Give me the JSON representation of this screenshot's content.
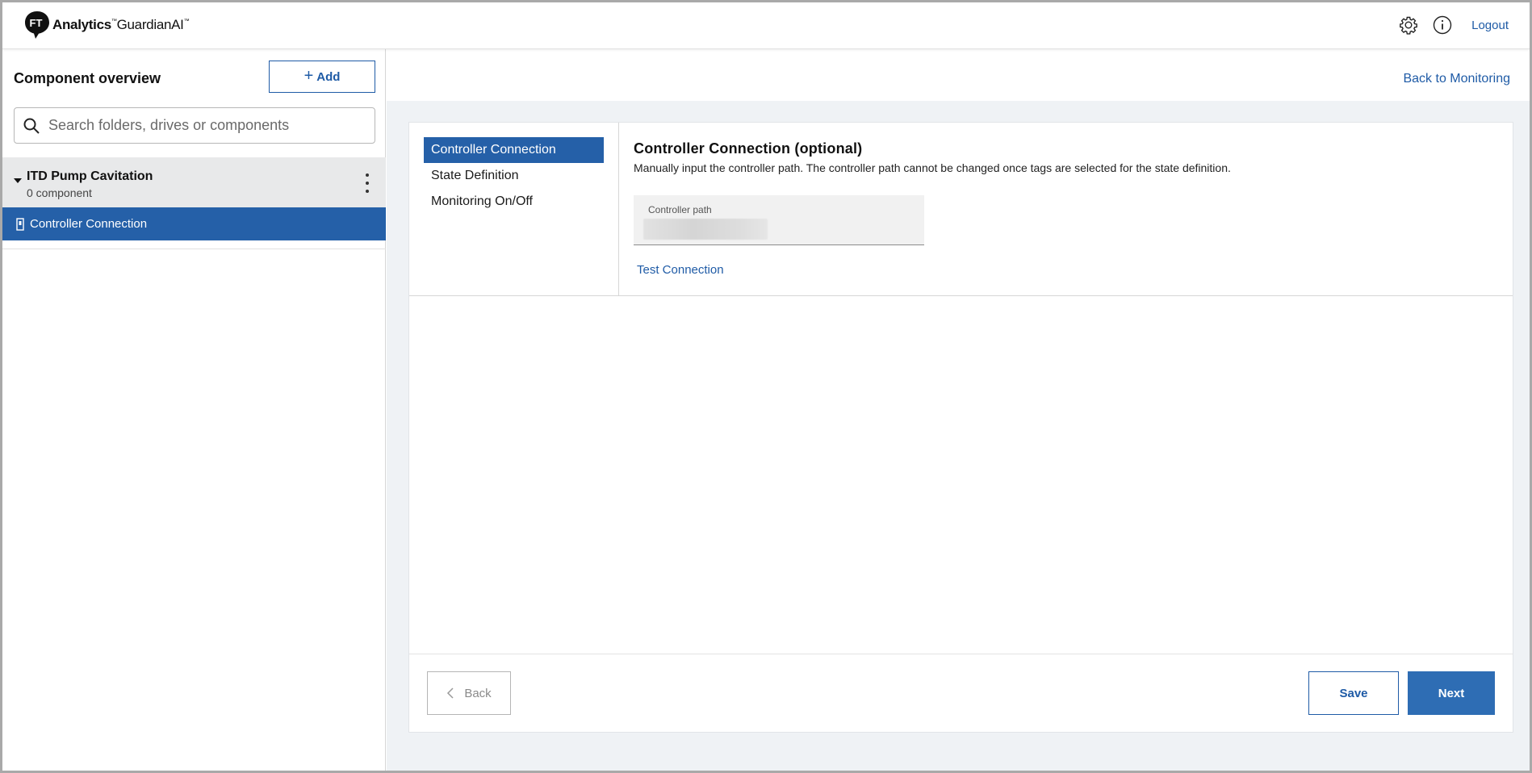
{
  "header": {
    "brand_strong": "Analytics",
    "brand_tm1": "™",
    "brand_light": "GuardianAI",
    "brand_tm2": "™",
    "logout_label": "Logout",
    "icons": [
      "gear-icon",
      "info-icon"
    ]
  },
  "sidebar": {
    "title": "Component overview",
    "add_label": "Add",
    "search_placeholder": "Search folders, drives or components",
    "folder": {
      "name": "ITD Pump Cavitation",
      "count": "0 component"
    },
    "selected_item": "Controller Connection"
  },
  "main": {
    "back_link": "Back to Monitoring",
    "steps": [
      {
        "label": "Controller Connection",
        "active": true
      },
      {
        "label": "State Definition",
        "active": false
      },
      {
        "label": "Monitoring On/Off",
        "active": false
      }
    ],
    "section_title": "Controller Connection (optional)",
    "section_desc": "Manually input the controller path. The controller path cannot be changed once tags are selected for the state definition.",
    "field_label": "Controller path",
    "test_connection": "Test Connection",
    "buttons": {
      "back": "Back",
      "save": "Save",
      "next": "Next"
    }
  },
  "colors": {
    "accent": "#1f5ba6",
    "selected_bg": "#2560a8",
    "next_bg": "#2e6db4",
    "content_bg": "#eff2f5"
  }
}
